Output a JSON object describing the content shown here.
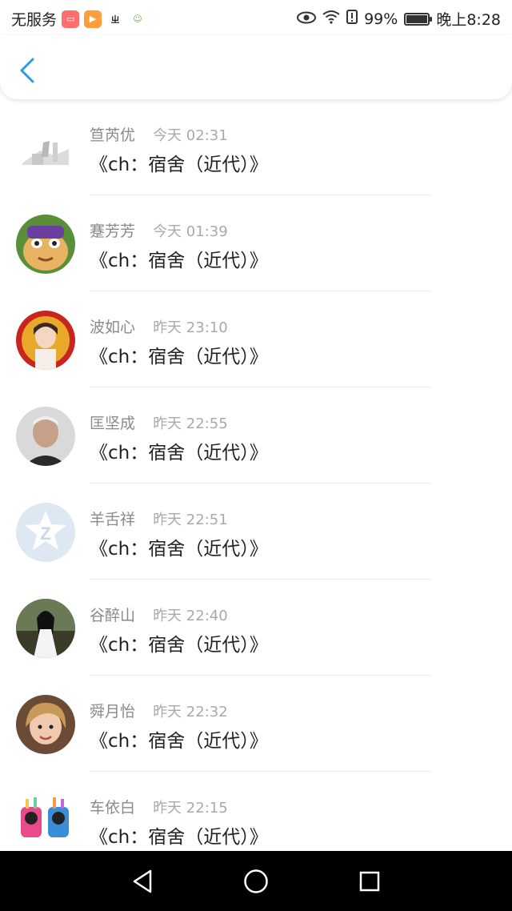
{
  "status_bar": {
    "carrier": "无服务",
    "battery_percent": "99%",
    "battery_level": 0.99,
    "time": "晚上8:28"
  },
  "messages": [
    {
      "name": "笪芮优",
      "time": "今天 02:31",
      "text": "《ch：宿舍（近代）》"
    },
    {
      "name": "蹇芳芳",
      "time": "今天 01:39",
      "text": "《ch：宿舍（近代）》"
    },
    {
      "name": "波如心",
      "time": "昨天 23:10",
      "text": "《ch：宿舍（近代）》"
    },
    {
      "name": "匡坚成",
      "time": "昨天 22:55",
      "text": "《ch：宿舍（近代）》"
    },
    {
      "name": "羊舌祥",
      "time": "昨天 22:51",
      "text": "《ch：宿舍（近代）》"
    },
    {
      "name": "谷醉山",
      "time": "昨天 22:40",
      "text": "《ch：宿舍（近代）》"
    },
    {
      "name": "舜月怡",
      "time": "昨天 22:32",
      "text": "《ch：宿舍（近代）》"
    },
    {
      "name": "车依白",
      "time": "昨天 22:15",
      "text": "《ch：宿舍（近代）》"
    }
  ],
  "colors": {
    "accent": "#2e9ae0",
    "name_text": "#8a8a8a",
    "time_text": "#a9a9a9"
  }
}
